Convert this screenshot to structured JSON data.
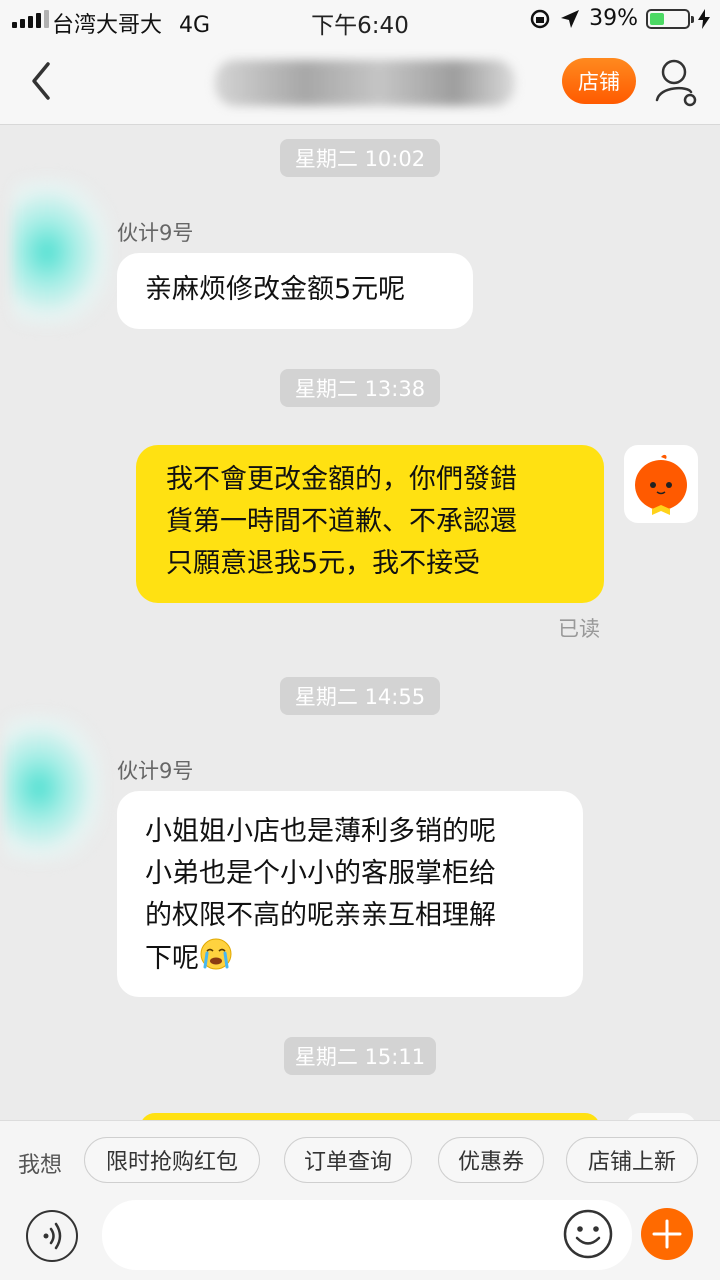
{
  "status_bar": {
    "carrier": "台湾大哥大",
    "network": "4G",
    "time": "下午6:40",
    "battery_percent": "39%",
    "battery_level": 0.39
  },
  "nav": {
    "shop_label": "店铺"
  },
  "messages": [
    {
      "timestamp": "星期二 10:02"
    },
    {
      "sender": "伙计9号",
      "lines": [
        "亲麻烦修改金额5元呢"
      ]
    },
    {
      "timestamp": "星期二 13:38"
    },
    {
      "lines": [
        "我不會更改金額的，你們發錯",
        "貨第一時間不道歉、不承認還",
        "只願意退我5元，我不接受"
      ],
      "status": "已读"
    },
    {
      "timestamp": "星期二 14:55"
    },
    {
      "sender": "伙计9号",
      "lines": [
        "小姐姐小店也是薄利多销的呢",
        "小弟也是个小小的客服掌柜给",
        "的权限不高的呢亲亲互相理解",
        "下呢"
      ]
    },
    {
      "timestamp": "星期二 15:11"
    }
  ],
  "quick_bar": {
    "label": "我想",
    "items": [
      "限时抢购红包",
      "订单查询",
      "优惠券",
      "店铺上新"
    ]
  },
  "input": {
    "placeholder": ""
  },
  "colors": {
    "accent": "#ff6a00",
    "my_bubble": "#ffe112",
    "background": "#ebebeb"
  }
}
